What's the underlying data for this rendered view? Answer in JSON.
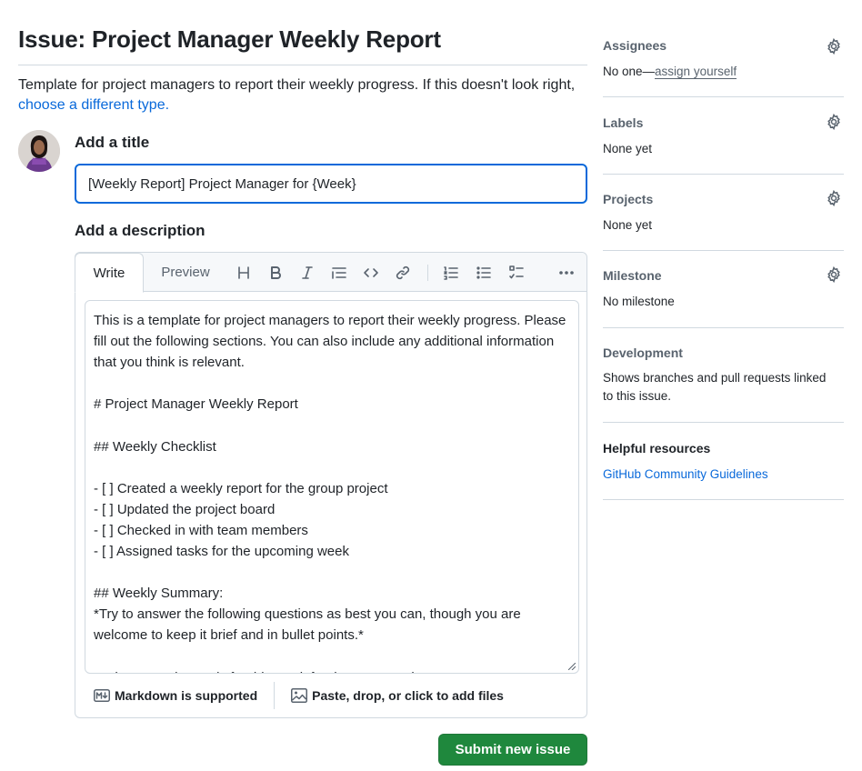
{
  "page": {
    "title": "Issue: Project Manager Weekly Report",
    "template_description": "Template for project managers to report their weekly progress. If this doesn't look right,",
    "choose_type_link": "choose a different type."
  },
  "form": {
    "title_label": "Add a title",
    "title_value": "[Weekly Report] Project Manager for {Week}",
    "description_label": "Add a description",
    "description_value": "This is a template for project managers to report their weekly progress. Please fill out the following sections. You can also include any additional information that you think is relevant.\n\n# Project Manager Weekly Report\n\n## Weekly Checklist\n\n- [ ] Created a weekly report for the group project\n- [ ] Updated the project board\n- [ ] Checked in with team members\n- [ ] Assigned tasks for the upcoming week\n\n## Weekly Summary:\n*Try to answer the following questions as best you can, though you are welcome to keep it brief and in bullet points.*\n\n- What were the goals for this week for the group project?",
    "submit_label": "Submit new issue"
  },
  "editor": {
    "tabs": [
      {
        "label": "Write",
        "active": true
      },
      {
        "label": "Preview",
        "active": false
      }
    ],
    "toolbar": [
      {
        "name": "heading-icon"
      },
      {
        "name": "bold-icon"
      },
      {
        "name": "italic-icon"
      },
      {
        "name": "quote-icon"
      },
      {
        "name": "code-icon"
      },
      {
        "name": "link-icon"
      },
      {
        "name": "ordered-list-icon"
      },
      {
        "name": "unordered-list-icon"
      },
      {
        "name": "task-list-icon"
      },
      {
        "name": "more-icon"
      }
    ],
    "footer": {
      "markdown_label": "Markdown is supported",
      "attach_label": "Paste, drop, or click to add files"
    }
  },
  "sidebar": {
    "assignees": {
      "heading": "Assignees",
      "none_text": "No one—",
      "assign_link": "assign yourself"
    },
    "labels": {
      "heading": "Labels",
      "value": "None yet"
    },
    "projects": {
      "heading": "Projects",
      "value": "None yet"
    },
    "milestone": {
      "heading": "Milestone",
      "value": "No milestone"
    },
    "development": {
      "heading": "Development",
      "value": "Shows branches and pull requests linked to this issue."
    },
    "helpful": {
      "heading": "Helpful resources",
      "link": "GitHub Community Guidelines"
    }
  },
  "colors": {
    "accent": "#0969da",
    "submit": "#1f883d",
    "border": "#d1d9e0",
    "muted": "#59636e"
  }
}
